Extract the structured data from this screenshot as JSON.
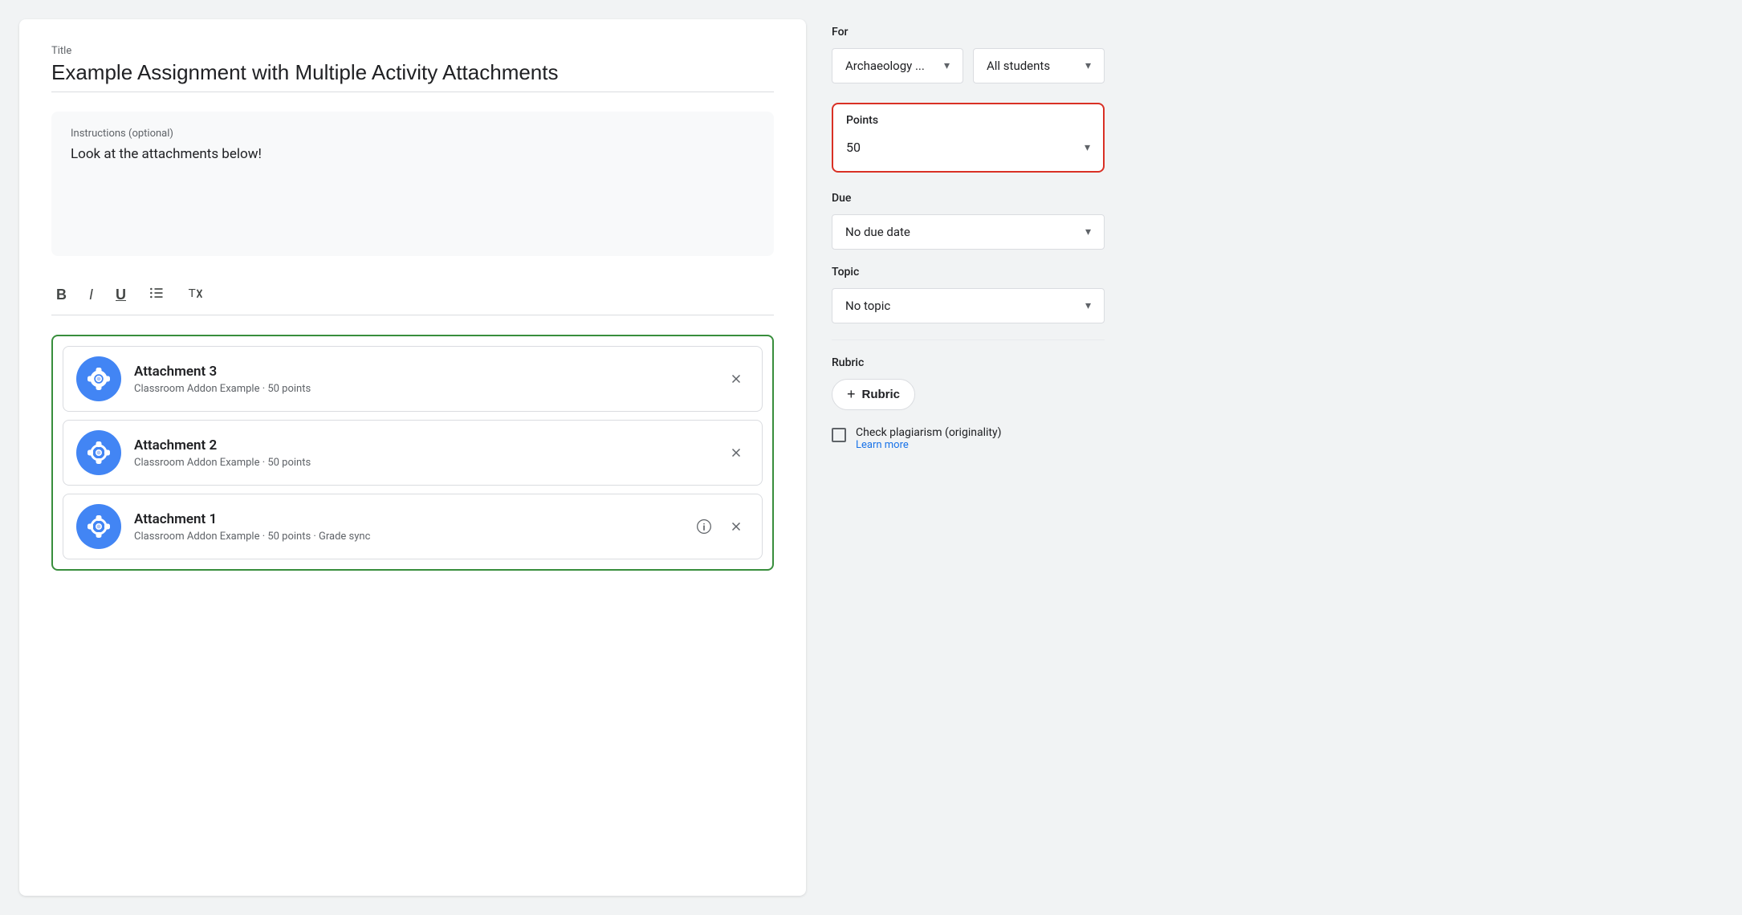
{
  "left": {
    "title_label": "Title",
    "title_value": "Example Assignment with Multiple Activity Attachments",
    "instructions_label": "Instructions (optional)",
    "instructions_text": "Look at the attachments below!",
    "toolbar": {
      "bold": "B",
      "italic": "I",
      "underline": "U",
      "list": "≡",
      "clear": "✗"
    },
    "attachments": [
      {
        "id": "attachment-3",
        "title": "Attachment 3",
        "subtitle": "Classroom Addon Example · 50 points",
        "has_info": false
      },
      {
        "id": "attachment-2",
        "title": "Attachment 2",
        "subtitle": "Classroom Addon Example · 50 points",
        "has_info": false
      },
      {
        "id": "attachment-1",
        "title": "Attachment 1",
        "subtitle": "Classroom Addon Example · 50 points · Grade sync",
        "has_info": true
      }
    ]
  },
  "right": {
    "for_label": "For",
    "class_value": "Archaeology ...",
    "students_value": "All students",
    "points_label": "Points",
    "points_value": "50",
    "due_label": "Due",
    "due_value": "No due date",
    "topic_label": "Topic",
    "topic_value": "No topic",
    "rubric_label": "Rubric",
    "rubric_btn": "Rubric",
    "plagiarism_main": "Check plagiarism (originality)",
    "plagiarism_sub": "Learn more"
  }
}
